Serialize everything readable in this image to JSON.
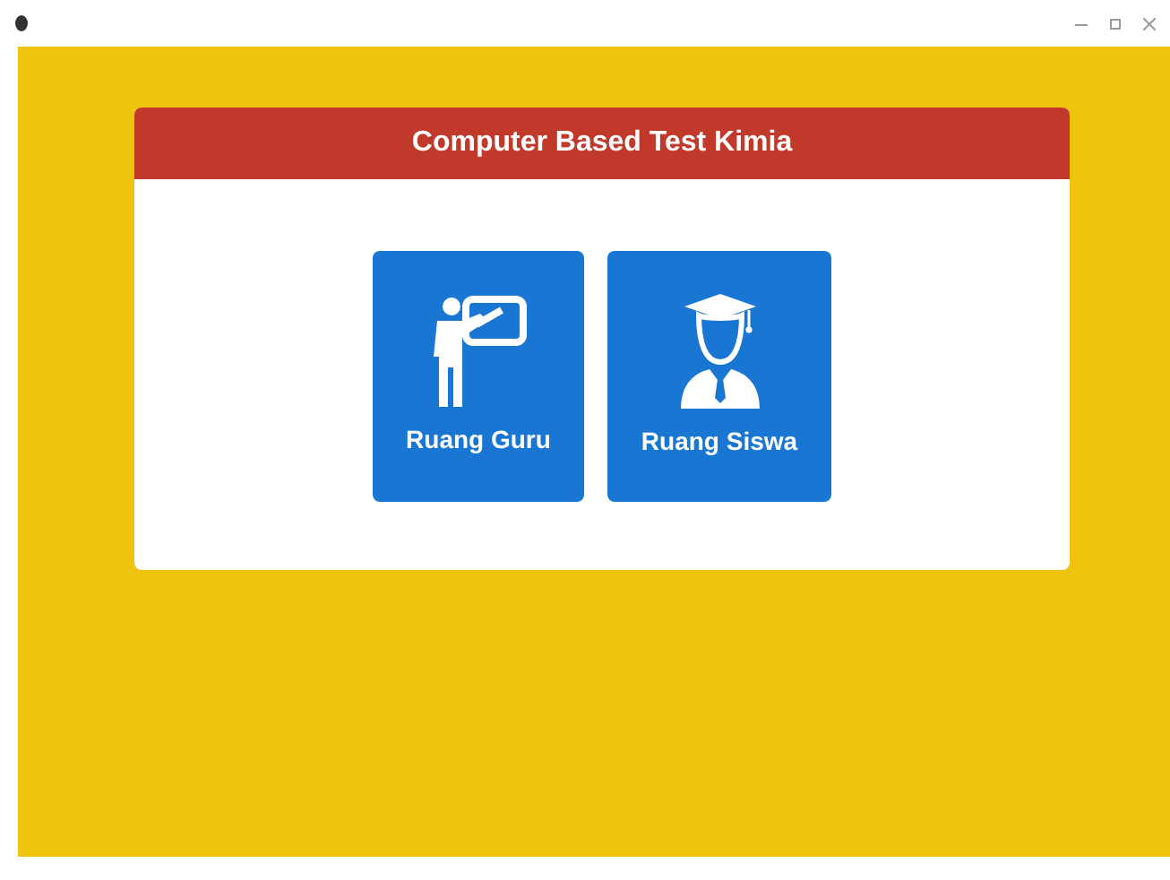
{
  "title": "Computer Based Test Kimia",
  "buttons": [
    {
      "kind": "teacher",
      "label": "Ruang Guru"
    },
    {
      "kind": "student",
      "label": "Ruang Siswa"
    }
  ]
}
